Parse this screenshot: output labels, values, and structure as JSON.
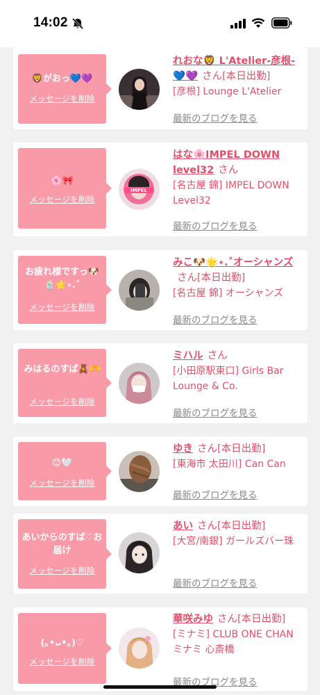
{
  "status_bar": {
    "time": "14:02"
  },
  "colors": {
    "accent": "#e0506b",
    "bubble": "#f99aa9",
    "link_gray": "#8a8a8a"
  },
  "cards": [
    {
      "message": "🦁がおっ💙💜",
      "delete_label": "メッセージを削除",
      "name": "れおな🦁 L'Atelier-彦根-💙💜",
      "honorific": "さん",
      "status": "[本日出勤]",
      "shop": "[彦根] Lounge L'Atelier",
      "blog_label": "最新のブログを見る"
    },
    {
      "message": "🌸🎀",
      "delete_label": "メッセージを削除",
      "name": "はな🌸IMPEL DOWN level32",
      "honorific": "さん",
      "status": "",
      "shop": "[名古屋 錦] IMPEL DOWN Level32",
      "blog_label": "最新のブログを見る"
    },
    {
      "message": "お疲れ様ですっ🐶🍵🌟⋆.˚",
      "delete_label": "メッセージを削除",
      "name": "みこ🐶🌟⋆.˚オーシャンズ",
      "honorific": "さん",
      "status": "[本日出勤]",
      "shop": "[名古屋 錦] オーシャンズ",
      "blog_label": "最新のブログを見る"
    },
    {
      "message": "みはるのすば🧸🫶",
      "delete_label": "メッセージを削除",
      "name": "ミハル",
      "honorific": "さん",
      "status": "",
      "shop": "[小田原駅東口] Girls Bar Lounge & Co.",
      "blog_label": "最新のブログを見る"
    },
    {
      "message": "😊🤍",
      "delete_label": "メッセージを削除",
      "name": "ゆき",
      "honorific": "さん",
      "status": "[本日出勤]",
      "shop": "[東海市 太田川] Can Can",
      "blog_label": "最新のブログを見る"
    },
    {
      "message": "あいからのすば♡お届け",
      "delete_label": "メッセージを削除",
      "name": "あい",
      "honorific": "さん",
      "status": "[本日出勤]",
      "shop": "[大宮/南銀] ガールズバー珠",
      "blog_label": "最新のブログを見る"
    },
    {
      "message": "(｡•ᴗ•｡)♡",
      "delete_label": "メッセージを削除",
      "name": "華咲みゆ",
      "honorific": "さん",
      "status": "[本日出勤]",
      "shop": "[ミナミ] CLUB ONE CHAN ミナミ 心斎橋",
      "blog_label": "最新のブログを見る"
    }
  ]
}
